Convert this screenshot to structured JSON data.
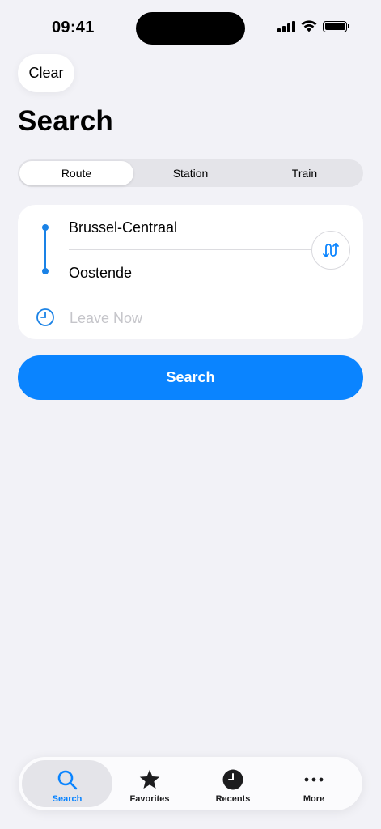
{
  "status_bar": {
    "time": "09:41"
  },
  "header": {
    "clear_label": "Clear",
    "title": "Search"
  },
  "segments": [
    {
      "label": "Route",
      "active": true
    },
    {
      "label": "Station",
      "active": false
    },
    {
      "label": "Train",
      "active": false
    }
  ],
  "route": {
    "from": "Brussel-Centraal",
    "to": "Oostende",
    "time_placeholder": "Leave Now"
  },
  "search_button": {
    "label": "Search"
  },
  "tab_bar": {
    "tabs": [
      {
        "label": "Search",
        "icon": "magnifier-icon",
        "active": true
      },
      {
        "label": "Favorites",
        "icon": "star-icon",
        "active": false
      },
      {
        "label": "Recents",
        "icon": "clock-icon",
        "active": false
      },
      {
        "label": "More",
        "icon": "ellipsis-icon",
        "active": false
      }
    ]
  },
  "colors": {
    "accent": "#0a84ff",
    "route_blue": "#1a82e6",
    "background": "#f2f2f7",
    "placeholder": "#c5c5ca"
  }
}
